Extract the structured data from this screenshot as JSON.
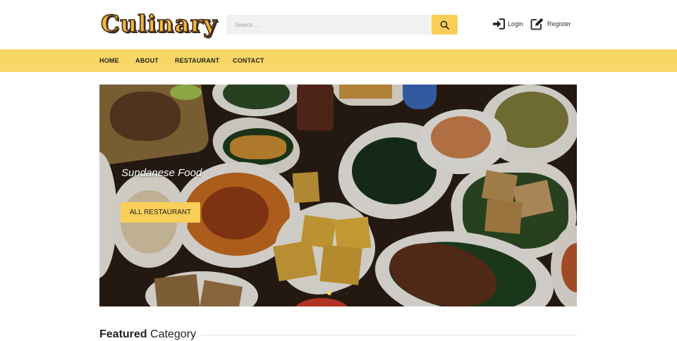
{
  "header": {
    "logo_text": "Culinary",
    "search_placeholder": "Search ...",
    "login_label": "Login",
    "register_label": "Register"
  },
  "nav": {
    "items": [
      {
        "label": "HOME"
      },
      {
        "label": "ABOUT"
      },
      {
        "label": "RESTAURANT"
      },
      {
        "label": "CONTACT"
      }
    ]
  },
  "hero": {
    "caption": "Sundanese Food",
    "button_label": "ALL RESTAURANT",
    "slide_count": 3,
    "active_slide": 1
  },
  "section": {
    "title_bold": "Featured",
    "title_rest": "Category"
  },
  "colors": {
    "accent": "#f9cf57",
    "nav_bg": "#f9d766",
    "logo": "#f6b73c"
  },
  "icons": [
    "search-icon",
    "login-icon",
    "edit-icon"
  ]
}
